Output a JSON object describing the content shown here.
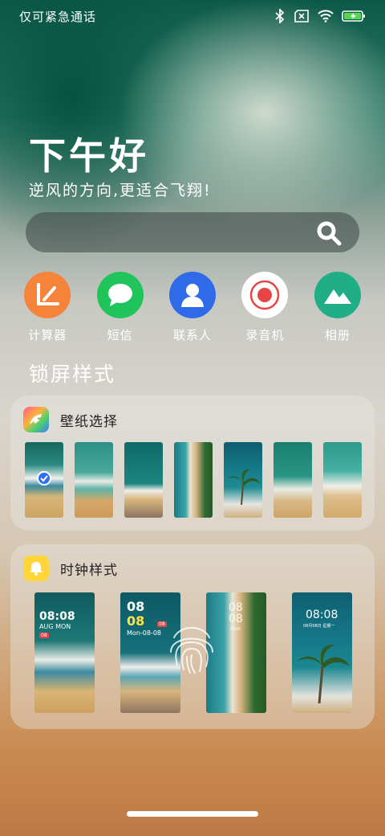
{
  "status": {
    "carrier": "仅可紧急通话"
  },
  "header": {
    "greeting": "下午好",
    "subtitle": "逆风的方向,更适合飞翔!"
  },
  "search": {
    "icon": "search-icon"
  },
  "apps": [
    {
      "label": "计算器",
      "icon": "calculator-icon",
      "color": "#f5843a"
    },
    {
      "label": "短信",
      "icon": "message-icon",
      "color": "#1fc55a"
    },
    {
      "label": "联系人",
      "icon": "contact-icon",
      "color": "#2f6be8"
    },
    {
      "label": "录音机",
      "icon": "recorder-icon",
      "color": "#ffffff"
    },
    {
      "label": "相册",
      "icon": "gallery-icon",
      "color": "#1fae86"
    }
  ],
  "lockscreen": {
    "section_title": "锁屏样式",
    "wallpaper_card": {
      "title": "壁纸选择"
    },
    "clock_card": {
      "title": "时钟样式",
      "styles": [
        {
          "time": "08:08",
          "date": "AUG MON",
          "badge": "08"
        },
        {
          "hour": "08",
          "minute": "08",
          "date": "Mon-08-08",
          "badge": "08"
        },
        {
          "hour": "08",
          "minute": "08",
          "date": "Mon"
        },
        {
          "time": "08:08",
          "date": "08月08日 星期一"
        }
      ]
    }
  }
}
